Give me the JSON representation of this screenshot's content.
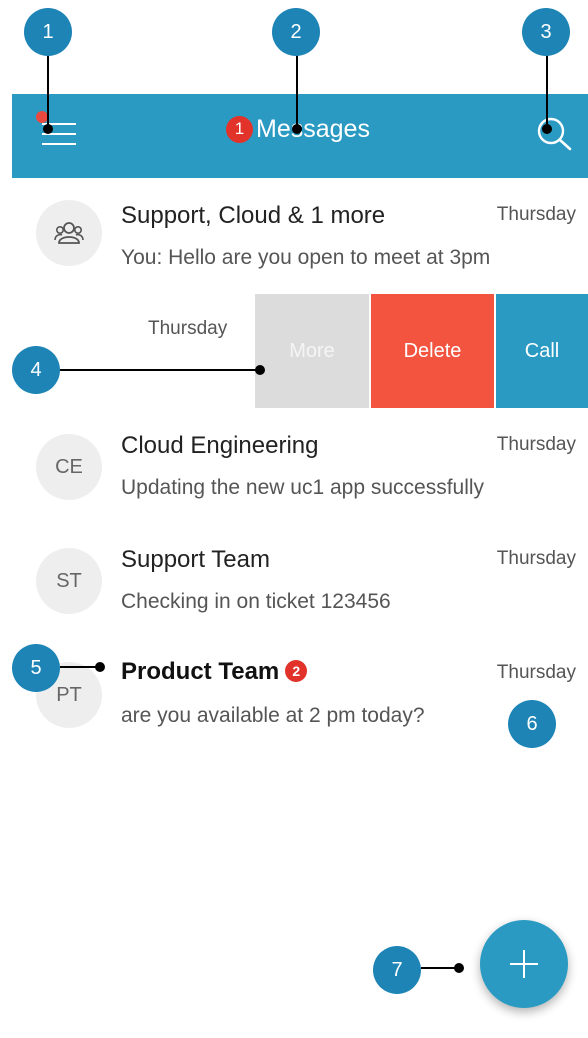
{
  "header": {
    "title": "Messages",
    "unread_count": "1"
  },
  "conversations": [
    {
      "initials": "",
      "icon": "group-icon",
      "name": "Support, Cloud & 1 more",
      "preview": "You: Hello are you open to meet at 3pm",
      "time": "Thursday"
    },
    {
      "time": "Thursday",
      "actions": {
        "more": "More",
        "delete": "Delete",
        "call": "Call"
      }
    },
    {
      "initials": "CE",
      "name": "Cloud Engineering",
      "preview": "Updating the new uc1 app successfully",
      "time": "Thursday"
    },
    {
      "initials": "ST",
      "name": "Support Team",
      "preview": "Checking in on ticket 123456",
      "time": "Thursday"
    },
    {
      "initials": "PT",
      "name": "Product Team",
      "unread": "2",
      "preview": "are you available at 2 pm today?",
      "time": "Thursday"
    }
  ],
  "callouts": [
    "1",
    "2",
    "3",
    "4",
    "5",
    "6",
    "7"
  ],
  "colors": {
    "accent": "#2a9ac3",
    "delete": "#f25440",
    "badge": "#e2332b",
    "callout": "#1d84b5"
  }
}
